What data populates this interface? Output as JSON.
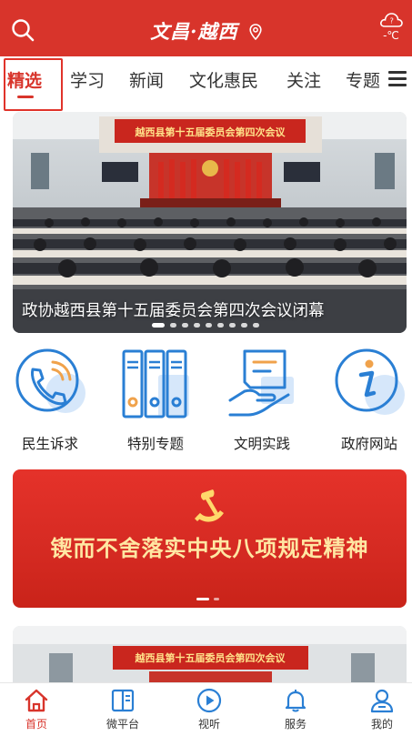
{
  "header": {
    "brand": "文昌·越西",
    "temperature": "-℃",
    "weather_level": "?",
    "icons": [
      "search-icon",
      "location-pin-icon",
      "weather-cloud-icon"
    ]
  },
  "tabs": [
    {
      "label": "精选",
      "active": true
    },
    {
      "label": "学习",
      "active": false
    },
    {
      "label": "新闻",
      "active": false
    },
    {
      "label": "文化惠民",
      "active": false
    },
    {
      "label": "关注",
      "active": false
    },
    {
      "label": "专题",
      "active": false
    }
  ],
  "banner": {
    "slide_title": "政协越西县第十五届委员会第四次会议闭幕",
    "hall_banner": "越西县第十五届委员会第四次会议",
    "slide_count": 9,
    "active_slide": 1
  },
  "services": [
    {
      "label": "民生诉求",
      "icon": "phone-bubble-icon"
    },
    {
      "label": "特别专题",
      "icon": "binders-icon"
    },
    {
      "label": "文明实践",
      "icon": "hand-document-icon"
    },
    {
      "label": "政府网站",
      "icon": "info-icon"
    }
  ],
  "promo": {
    "title": "锲而不舍落实中央八项规定精神",
    "emblem": "party-emblem-icon",
    "slide_count": 2,
    "active_slide": 1
  },
  "card2": {
    "hall_banner": "越西县第十五届委员会第四次会议"
  },
  "bottom_nav": [
    {
      "label": "首页",
      "icon": "home-icon",
      "active": true
    },
    {
      "label": "微平台",
      "icon": "book-icon",
      "active": false
    },
    {
      "label": "视听",
      "icon": "play-icon",
      "active": false
    },
    {
      "label": "服务",
      "icon": "bell-icon",
      "active": false
    },
    {
      "label": "我的",
      "icon": "user-icon",
      "active": false
    }
  ],
  "colors": {
    "brand_red": "#d8342b",
    "accent_blue": "#2a7fd4",
    "promo_gold": "#ffe7a3"
  }
}
